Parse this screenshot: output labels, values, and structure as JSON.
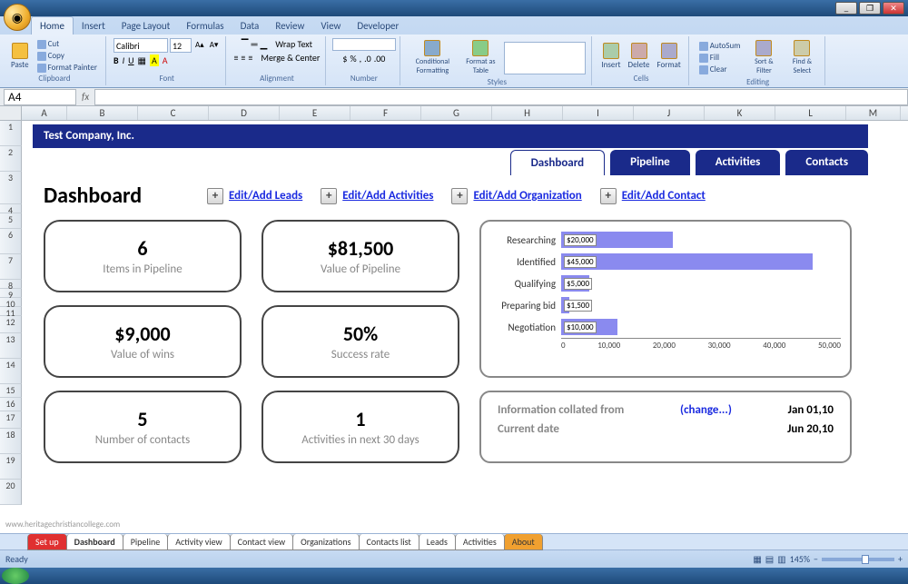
{
  "window": {
    "min": "_",
    "max": "❐",
    "close": "✕"
  },
  "ribbon": {
    "tabs": [
      "Home",
      "Insert",
      "Page Layout",
      "Formulas",
      "Data",
      "Review",
      "View",
      "Developer"
    ],
    "active_tab": "Home",
    "clipboard": {
      "label": "Clipboard",
      "paste": "Paste",
      "cut": "Cut",
      "copy": "Copy",
      "fp": "Format Painter"
    },
    "font": {
      "label": "Font",
      "name": "Calibri",
      "size": "12"
    },
    "alignment": {
      "label": "Alignment",
      "wrap": "Wrap Text",
      "merge": "Merge & Center"
    },
    "number": {
      "label": "Number",
      "general": ""
    },
    "styles": {
      "label": "Styles",
      "cf": "Conditional Formatting",
      "fat": "Format as Table"
    },
    "cells": {
      "label": "Cells",
      "insert": "Insert",
      "delete": "Delete",
      "format": "Format"
    },
    "editing": {
      "label": "Editing",
      "autosum": "AutoSum",
      "fill": "Fill",
      "clear": "Clear",
      "sort": "Sort & Filter",
      "find": "Find & Select"
    }
  },
  "formula": {
    "name_box": "A4",
    "fx": "fx"
  },
  "cols": [
    "A",
    "B",
    "C",
    "D",
    "E",
    "F",
    "G",
    "H",
    "I",
    "J",
    "K",
    "L",
    "M"
  ],
  "rows": [
    "1",
    "2",
    "3",
    "4",
    "5",
    "6",
    "7",
    "8",
    "9",
    "10",
    "11",
    "12",
    "13",
    "14",
    "15",
    "16",
    "17",
    "18",
    "19",
    "20"
  ],
  "company": "Test Company, Inc.",
  "nav": {
    "dashboard": "Dashboard",
    "pipeline": "Pipeline",
    "activities": "Activities",
    "contacts": "Contacts"
  },
  "heading": "Dashboard",
  "links": {
    "leads": "Edit/Add Leads",
    "activities": "Edit/Add Activities",
    "org": "Edit/Add Organization",
    "contact": "Edit/Add Contact"
  },
  "cards": {
    "pipeline_items": {
      "val": "6",
      "lbl": "Items in Pipeline"
    },
    "pipeline_value": {
      "val": "$81,500",
      "lbl": "Value of Pipeline"
    },
    "wins_value": {
      "val": "$9,000",
      "lbl": "Value of wins"
    },
    "success": {
      "val": "50%",
      "lbl": "Success rate"
    },
    "contacts": {
      "val": "5",
      "lbl": "Number of contacts"
    },
    "activities30": {
      "val": "1",
      "lbl": "Activities in next 30 days"
    }
  },
  "chart_data": {
    "type": "bar",
    "categories": [
      "Researching",
      "Identified",
      "Qualifying",
      "Preparing bid",
      "Negotiation"
    ],
    "values": [
      20000,
      45000,
      5000,
      1500,
      10000
    ],
    "value_labels": [
      "$20,000",
      "$45,000",
      "$5,000",
      "$1,500",
      "$10,000"
    ],
    "xlim": [
      0,
      50000
    ],
    "ticks": [
      "0",
      "10,000",
      "20,000",
      "30,000",
      "40,000",
      "50,000"
    ],
    "title": "",
    "xlabel": "",
    "ylabel": ""
  },
  "info": {
    "collated_lbl": "Information collated from",
    "change": "(change...)",
    "collated_val": "Jan 01,10",
    "current_lbl": "Current date",
    "current_val": "Jun 20,10"
  },
  "sheet_tabs": [
    "Set up",
    "Dashboard",
    "Pipeline",
    "Activity view",
    "Contact view",
    "Organizations",
    "Contacts list",
    "Leads",
    "Activities",
    "About"
  ],
  "status": {
    "ready": "Ready",
    "zoom": "145%"
  },
  "watermark": "www.heritagechristiancollege.com"
}
